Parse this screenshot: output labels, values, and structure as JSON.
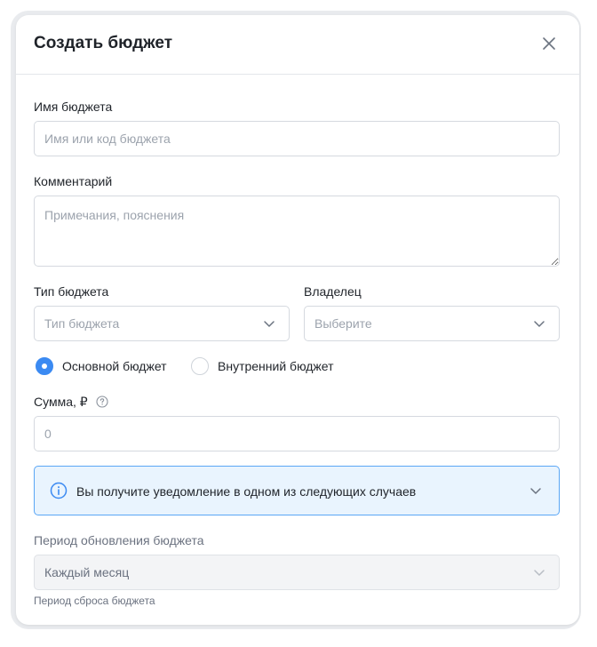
{
  "dialog": {
    "title": "Создать бюджет",
    "close_icon": "close-icon"
  },
  "form": {
    "name": {
      "label": "Имя бюджета",
      "placeholder": "Имя или код бюджета",
      "value": ""
    },
    "comment": {
      "label": "Комментарий",
      "placeholder": "Примечания, пояснения",
      "value": ""
    },
    "type": {
      "label": "Тип бюджета",
      "placeholder": "Тип бюджета",
      "icon": "chevron-down-icon"
    },
    "owner": {
      "label": "Владелец",
      "placeholder": "Выберите",
      "icon": "chevron-down-icon"
    },
    "budget_kind": {
      "options": [
        {
          "label": "Основной бюджет",
          "selected": true
        },
        {
          "label": "Внутренний бюджет",
          "selected": false
        }
      ]
    },
    "amount": {
      "label": "Сумма, ₽",
      "help_icon": "question-circle-icon",
      "placeholder": "0",
      "value": ""
    },
    "notification": {
      "text": "Вы получите уведомление в одном из следующих случаев",
      "icon": "info-icon",
      "expand_icon": "chevron-down-icon"
    },
    "period": {
      "label": "Период обновления бюджета",
      "value": "Каждый месяц",
      "disabled": true,
      "hint": "Период сброса бюджета"
    }
  },
  "colors": {
    "accent": "#3b8af2",
    "info_bg": "#e9f4fe",
    "info_border": "#5aa6f5",
    "border": "#d5d9df",
    "placeholder": "#9ca3ad",
    "disabled_bg": "#f3f4f6"
  }
}
